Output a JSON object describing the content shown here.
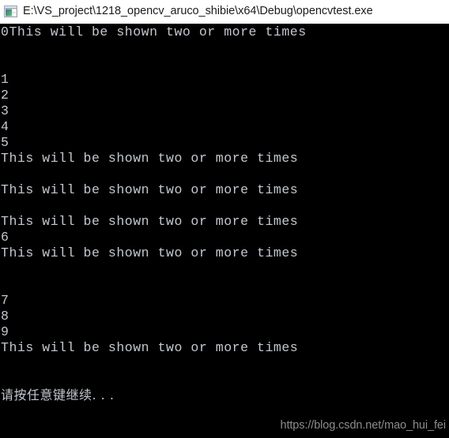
{
  "window": {
    "title": "E:\\VS_project\\1218_opencv_aruco_shibie\\x64\\Debug\\opencvtest.exe",
    "icon": "console-window-icon",
    "titlebar_bg": "#ffffff",
    "titlebar_fg": "#1b1b1b"
  },
  "console": {
    "background": "#000000",
    "foreground": "#c3c8d0",
    "lines": [
      "0This will be shown two or more times",
      "",
      "",
      "1",
      "2",
      "3",
      "4",
      "5",
      "This will be shown two or more times",
      "",
      "This will be shown two or more times",
      "",
      "This will be shown two or more times",
      "6",
      "This will be shown two or more times",
      "",
      "",
      "7",
      "8",
      "9",
      "This will be shown two or more times",
      "",
      "",
      "请按任意键继续. . ."
    ]
  },
  "watermark": {
    "text": "https://blog.csdn.net/mao_hui_fei",
    "color": "#8c8c8c"
  }
}
